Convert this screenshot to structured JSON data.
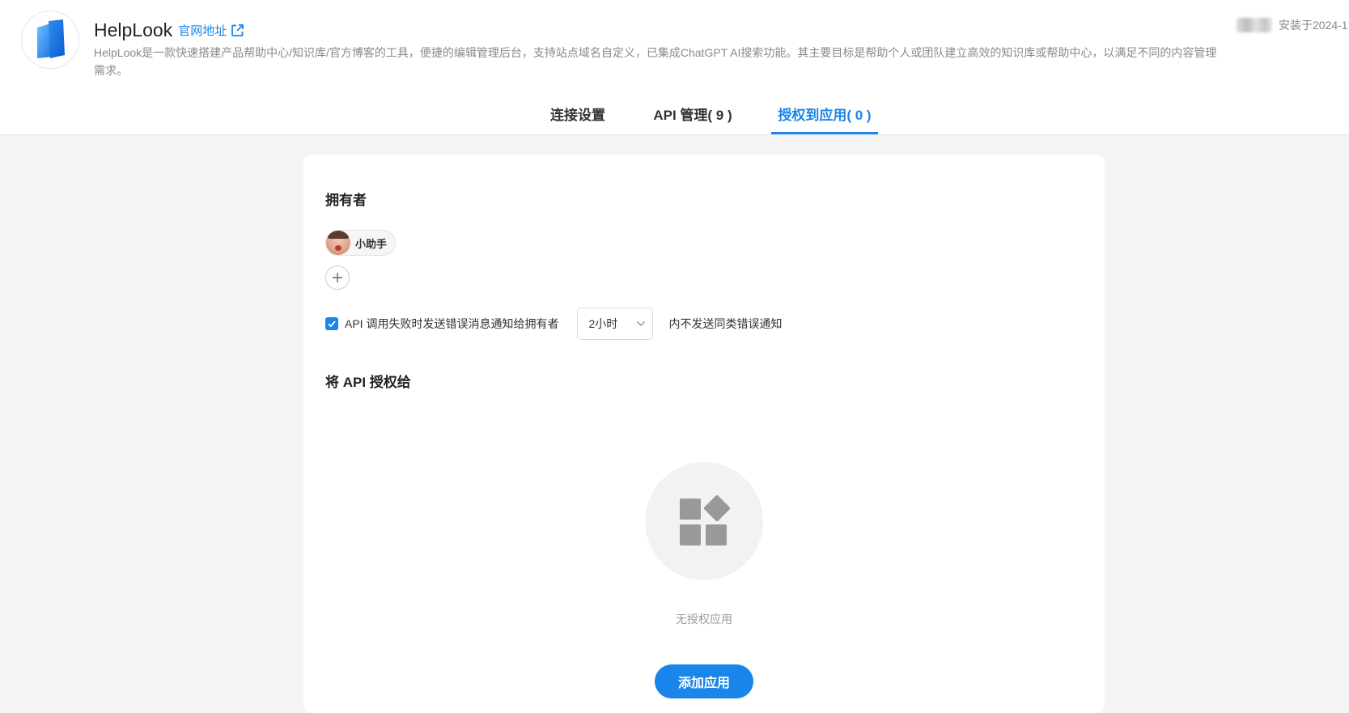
{
  "app": {
    "name": "HelpLook",
    "site_link_label": "官网地址",
    "description": "HelpLook是一款快速搭建产品帮助中心/知识库/官方博客的工具，便捷的编辑管理后台，支持站点域名自定义，已集成ChatGPT AI搜索功能。其主要目标是帮助个人或团队建立高效的知识库或帮助中心，以满足不同的内容管理需求。",
    "install_info": "安装于2024-1",
    "logo_colors": {
      "primary": "#1a85ea",
      "secondary": "#5ab8ff"
    }
  },
  "tabs": [
    {
      "label": "连接设置",
      "active": false
    },
    {
      "label": "API 管理( 9 )",
      "active": false
    },
    {
      "label": "授权到应用( 0 )",
      "active": true
    }
  ],
  "owners_section": {
    "title": "拥有者",
    "owners": [
      {
        "name": "小助手"
      }
    ]
  },
  "notify": {
    "checked": true,
    "label": "API 调用失败时发送错误消息通知给拥有者",
    "interval_selected": "2小时",
    "suffix": "内不发送同类错误通知"
  },
  "grant_section": {
    "title": "将 API 授权给",
    "empty_text": "无授权应用",
    "add_button_label": "添加应用"
  },
  "colors": {
    "accent": "#1a85ea"
  }
}
